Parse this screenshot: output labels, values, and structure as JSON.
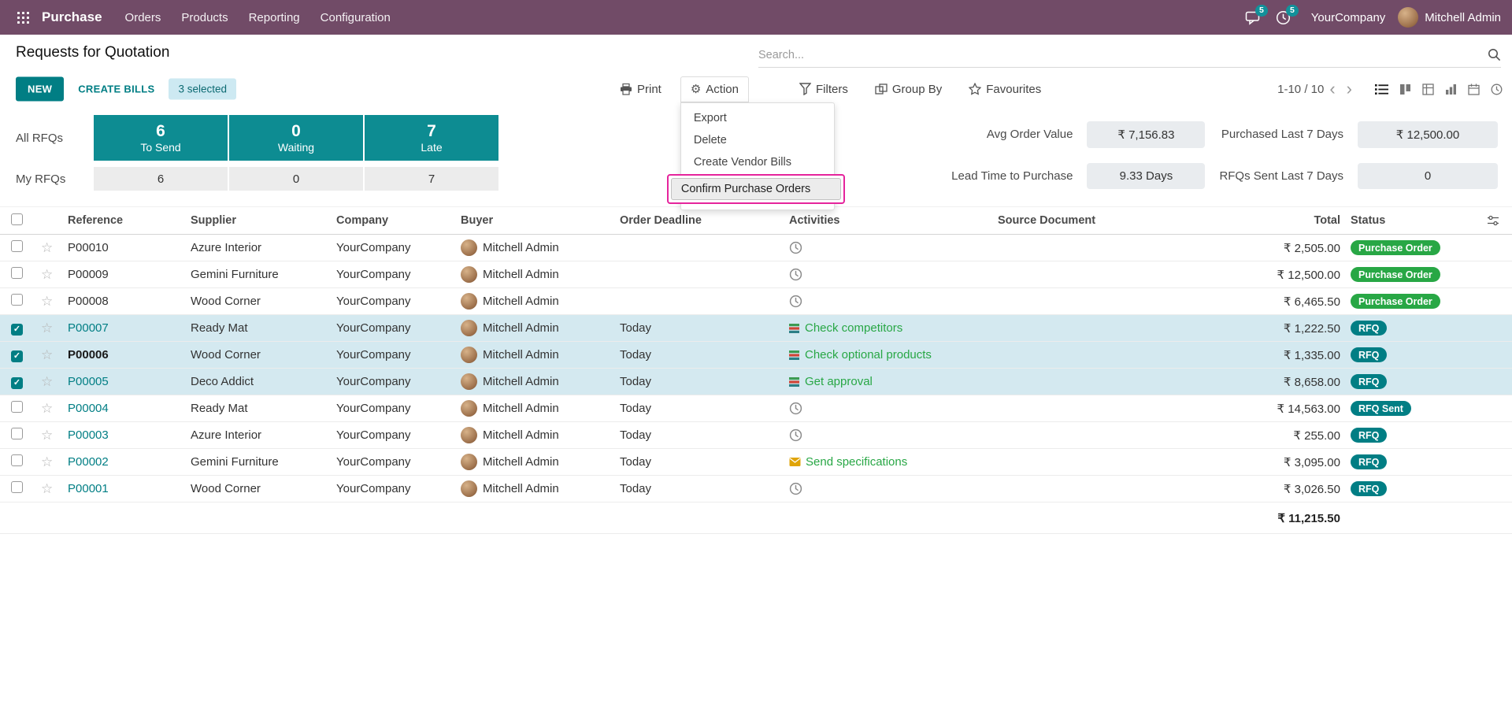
{
  "ui_colors": {
    "navbar_bg": "#714B67",
    "accent_teal": "#017e84",
    "kpi_card_bg": "#0d8c92",
    "selected_row_bg": "#d4e9f0",
    "status_confirmed_green": "#28a745",
    "status_rfq_teal": "#017e84",
    "annotation_highlight": "#e5249c"
  },
  "icons": {
    "apps": "grid-3x3-dots",
    "messages": "speech-bubble",
    "activities_nav": "clock",
    "search": "magnifier",
    "print": "printer",
    "action": "gear",
    "filters": "funnel",
    "group_by": "grouped-rectangles",
    "favourites": "star",
    "view_switcher": [
      "list",
      "kanban",
      "pivot",
      "graph",
      "calendar",
      "activity"
    ],
    "row_no_activity": "clock",
    "row_activity_task": "colored-task-rows",
    "row_activity_mail": "yellow-envelope",
    "optional_columns": "sliders"
  },
  "navbar": {
    "brand": "Purchase",
    "menus": [
      "Orders",
      "Products",
      "Reporting",
      "Configuration"
    ],
    "messages_badge": "5",
    "activities_badge": "5",
    "company": "YourCompany",
    "user": "Mitchell Admin"
  },
  "control_panel": {
    "title": "Requests for Quotation",
    "search_placeholder": "Search...",
    "new_label": "NEW",
    "create_bills_label": "CREATE BILLS",
    "selected_badge": "3 selected",
    "print_label": "Print",
    "action_label": "Action",
    "filters_label": "Filters",
    "group_by_label": "Group By",
    "favourites_label": "Favourites",
    "pager": "1-10 / 10",
    "pager_prev": "‹",
    "pager_next": "›"
  },
  "action_menu": {
    "items": [
      "Export",
      "Delete",
      "Create Vendor Bills"
    ],
    "highlighted_item": "Confirm Purchase Orders"
  },
  "dashboard": {
    "all_rfqs_label": "All RFQs",
    "my_rfqs_label": "My RFQs",
    "cards": [
      {
        "value": "6",
        "label": "To Send",
        "my_value": "6"
      },
      {
        "value": "0",
        "label": "Waiting",
        "my_value": "0"
      },
      {
        "value": "7",
        "label": "Late",
        "my_value": "7"
      }
    ],
    "stats": [
      {
        "label": "Avg Order Value",
        "value": "₹ 7,156.83"
      },
      {
        "label": "Lead Time to Purchase",
        "value": "9.33 Days"
      },
      {
        "label": "Purchased Last 7 Days",
        "value": "₹ 12,500.00"
      },
      {
        "label": "RFQs Sent Last 7 Days",
        "value": "0"
      }
    ]
  },
  "table": {
    "columns": {
      "reference": "Reference",
      "supplier": "Supplier",
      "company": "Company",
      "buyer": "Buyer",
      "deadline": "Order Deadline",
      "activities": "Activities",
      "source": "Source Document",
      "total": "Total",
      "status": "Status"
    },
    "rows": [
      {
        "reference": "P00010",
        "ref_style": "plain",
        "supplier": "Azure Interior",
        "company": "YourCompany",
        "buyer": "Mitchell Admin",
        "order_deadline": "",
        "activity_icon": "clock",
        "activity_label": "",
        "source_document": "",
        "total": "₹ 2,505.00",
        "status": "Purchase Order",
        "selected": false
      },
      {
        "reference": "P00009",
        "ref_style": "plain",
        "supplier": "Gemini Furniture",
        "company": "YourCompany",
        "buyer": "Mitchell Admin",
        "order_deadline": "",
        "activity_icon": "clock",
        "activity_label": "",
        "source_document": "",
        "total": "₹ 12,500.00",
        "status": "Purchase Order",
        "selected": false
      },
      {
        "reference": "P00008",
        "ref_style": "plain",
        "supplier": "Wood Corner",
        "company": "YourCompany",
        "buyer": "Mitchell Admin",
        "order_deadline": "",
        "activity_icon": "clock",
        "activity_label": "",
        "source_document": "",
        "total": "₹ 6,465.50",
        "status": "Purchase Order",
        "selected": false
      },
      {
        "reference": "P00007",
        "ref_style": "link",
        "supplier": "Ready Mat",
        "company": "YourCompany",
        "buyer": "Mitchell Admin",
        "order_deadline": "Today",
        "activity_icon": "tasks",
        "activity_label": "Check competitors",
        "source_document": "",
        "total": "₹ 1,222.50",
        "status": "RFQ",
        "selected": true
      },
      {
        "reference": "P00006",
        "ref_style": "bold",
        "supplier": "Wood Corner",
        "company": "YourCompany",
        "buyer": "Mitchell Admin",
        "order_deadline": "Today",
        "activity_icon": "tasks",
        "activity_label": "Check optional products",
        "source_document": "",
        "total": "₹ 1,335.00",
        "status": "RFQ",
        "selected": true
      },
      {
        "reference": "P00005",
        "ref_style": "link",
        "supplier": "Deco Addict",
        "company": "YourCompany",
        "buyer": "Mitchell Admin",
        "order_deadline": "Today",
        "activity_icon": "tasks",
        "activity_label": "Get approval",
        "source_document": "",
        "total": "₹ 8,658.00",
        "status": "RFQ",
        "selected": true
      },
      {
        "reference": "P00004",
        "ref_style": "link",
        "supplier": "Ready Mat",
        "company": "YourCompany",
        "buyer": "Mitchell Admin",
        "order_deadline": "Today",
        "activity_icon": "clock",
        "activity_label": "",
        "source_document": "",
        "total": "₹ 14,563.00",
        "status": "RFQ Sent",
        "selected": false
      },
      {
        "reference": "P00003",
        "ref_style": "link",
        "supplier": "Azure Interior",
        "company": "YourCompany",
        "buyer": "Mitchell Admin",
        "order_deadline": "Today",
        "activity_icon": "clock",
        "activity_label": "",
        "source_document": "",
        "total": "₹ 255.00",
        "status": "RFQ",
        "selected": false
      },
      {
        "reference": "P00002",
        "ref_style": "link",
        "supplier": "Gemini Furniture",
        "company": "YourCompany",
        "buyer": "Mitchell Admin",
        "order_deadline": "Today",
        "activity_icon": "mail",
        "activity_label": "Send specifications",
        "source_document": "",
        "total": "₹ 3,095.00",
        "status": "RFQ",
        "selected": false
      },
      {
        "reference": "P00001",
        "ref_style": "link",
        "supplier": "Wood Corner",
        "company": "YourCompany",
        "buyer": "Mitchell Admin",
        "order_deadline": "Today",
        "activity_icon": "clock",
        "activity_label": "",
        "source_document": "",
        "total": "₹ 3,026.50",
        "status": "RFQ",
        "selected": false
      }
    ],
    "footer_total": "₹ 11,215.50"
  }
}
